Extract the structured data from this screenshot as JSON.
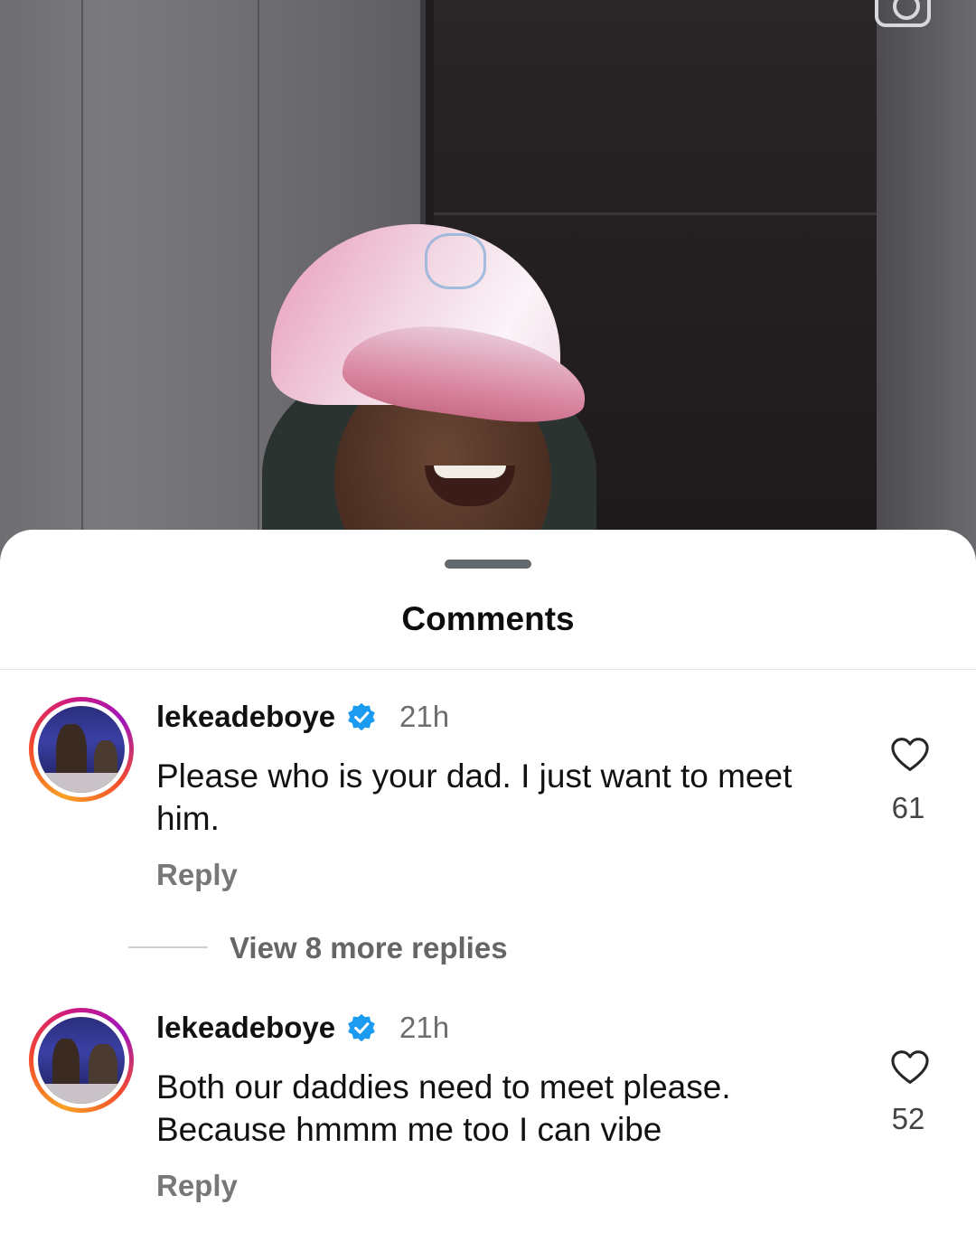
{
  "video": {
    "description_icon": "camera-icon"
  },
  "sheet": {
    "title": "Comments"
  },
  "comments": [
    {
      "username": "lekeadeboye",
      "verified": true,
      "timestamp": "21h",
      "text": "Please who is your dad. I just want to meet him.",
      "reply_label": "Reply",
      "likes": "61"
    },
    {
      "username": "lekeadeboye",
      "verified": true,
      "timestamp": "21h",
      "text": "Both our daddies need to meet please. Because hmmm me too I can vibe",
      "reply_label": "Reply",
      "likes": "52"
    }
  ],
  "view_replies": {
    "label": "View 8 more replies"
  },
  "colors": {
    "verified_badge": "#1d9bf0",
    "handle": "#63686d"
  }
}
